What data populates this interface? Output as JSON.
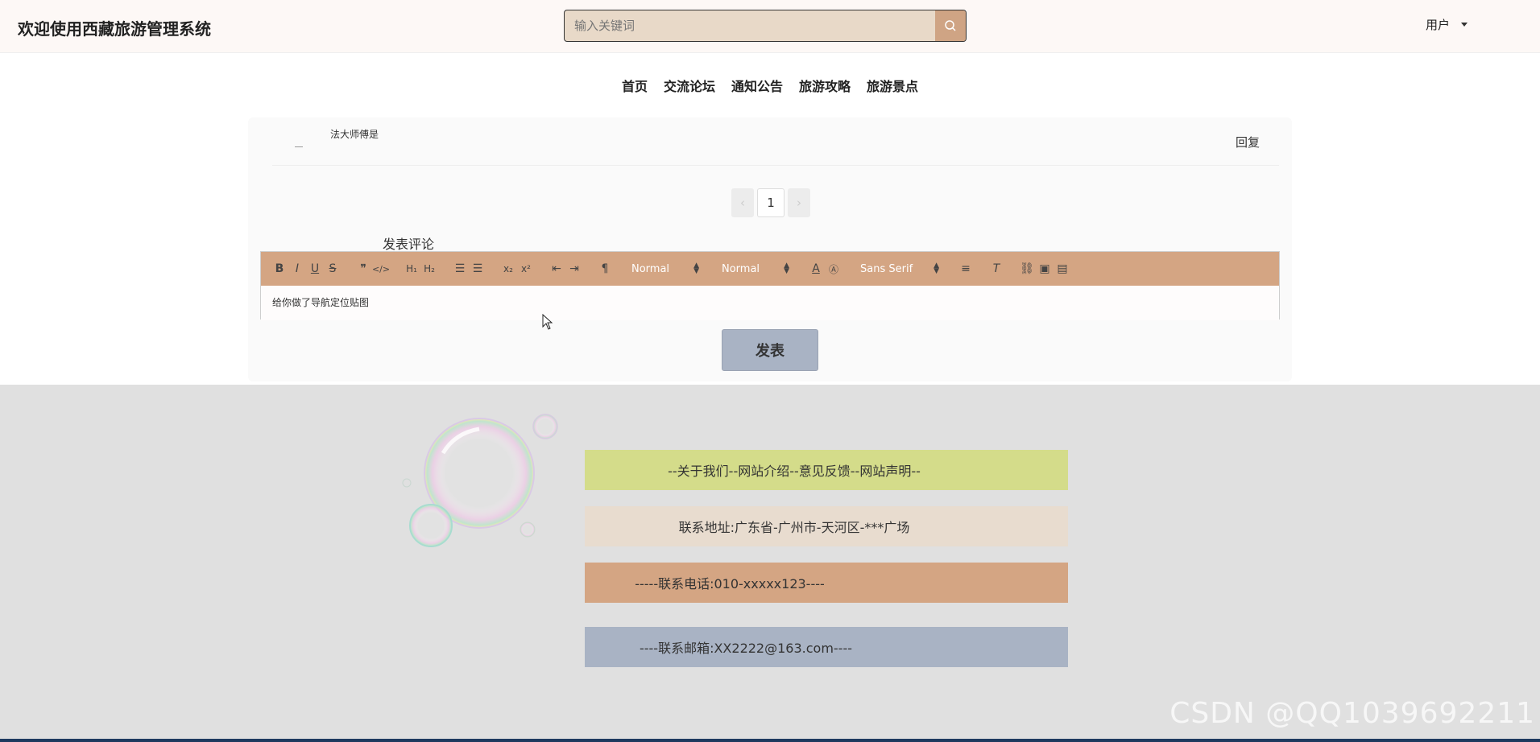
{
  "header": {
    "title": "欢迎使用西藏旅游管理系统",
    "search_placeholder": "输入关键词",
    "user_label": "用户"
  },
  "nav": {
    "items": [
      "首页",
      "交流论坛",
      "通知公告",
      "旅游攻略",
      "旅游景点"
    ]
  },
  "comments": [
    {
      "text": "法大师傅是",
      "reply_label": "回复"
    }
  ],
  "pagination": {
    "prev": "‹",
    "current": "1",
    "next": "›"
  },
  "post_section": {
    "label": "发表评论",
    "editor_content": "给你做了导航定位贴图",
    "toolbar": {
      "header_select": "Normal",
      "size_select": "Normal",
      "font_select": "Sans Serif"
    },
    "publish_label": "发表"
  },
  "footer": {
    "about": "--关于我们--网站介绍--意见反馈--网站声明--",
    "address": "联系地址:广东省-广州市-天河区-***广场",
    "phone": "-----联系电话:010-xxxxx123----",
    "email": "----联系邮箱:XX2222@163.com----"
  },
  "watermark": "CSDN @QQ1039692211",
  "colors": {
    "accent": "#d4a583",
    "search_bg": "#e8d9c8",
    "button_bg": "#a9b3c4",
    "footer_bg": "#e0e0e0",
    "bar_green": "#d4dc8a",
    "bar_beige": "#e8dccf"
  }
}
